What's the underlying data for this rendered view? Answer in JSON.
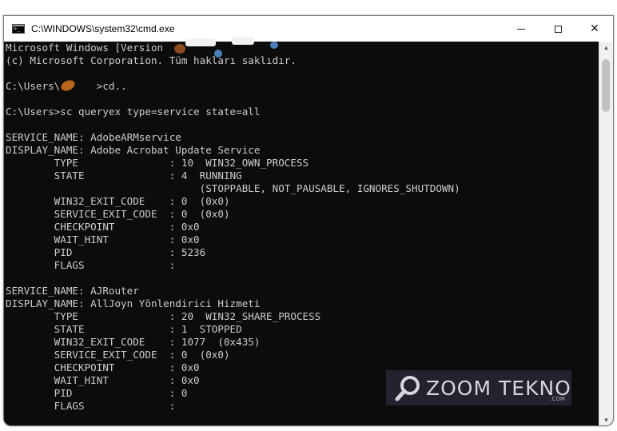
{
  "window": {
    "title": "C:\\WINDOWS\\system32\\cmd.exe",
    "minimize_glyph": "",
    "maximize_glyph": "",
    "close_glyph": "✕"
  },
  "console": {
    "lines": [
      "Microsoft Windows [Version",
      "(c) Microsoft Corporation. Tüm hakları saklıdır.",
      "",
      "C:\\Users\\      >cd..",
      "",
      "C:\\Users>sc queryex type=service state=all",
      "",
      "SERVICE_NAME: AdobeARMservice",
      "DISPLAY_NAME: Adobe Acrobat Update Service",
      "        TYPE               : 10  WIN32_OWN_PROCESS",
      "        STATE              : 4  RUNNING",
      "                                (STOPPABLE, NOT_PAUSABLE, IGNORES_SHUTDOWN)",
      "        WIN32_EXIT_CODE    : 0  (0x0)",
      "        SERVICE_EXIT_CODE  : 0  (0x0)",
      "        CHECKPOINT         : 0x0",
      "        WAIT_HINT          : 0x0",
      "        PID                : 5236",
      "        FLAGS              :",
      "",
      "SERVICE_NAME: AJRouter",
      "DISPLAY_NAME: AllJoyn Yönlendirici Hizmeti",
      "        TYPE               : 20  WIN32_SHARE_PROCESS",
      "        STATE              : 1  STOPPED",
      "        WIN32_EXIT_CODE    : 1077  (0x435)",
      "        SERVICE_EXIT_CODE  : 0  (0x0)",
      "        CHECKPOINT         : 0x0",
      "        WAIT_HINT          : 0x0",
      "        PID                : 0",
      "        FLAGS              :"
    ]
  },
  "scrollbar": {
    "up_glyph": "▲",
    "down_glyph": "▼"
  },
  "watermark": {
    "text": "ZOOM TEKNO",
    "sub": ".COM",
    "color": "#d6d6e0"
  },
  "colors": {
    "console_bg": "#0c0c0c",
    "console_fg": "#cccccc",
    "titlebar_bg": "#ffffff"
  }
}
